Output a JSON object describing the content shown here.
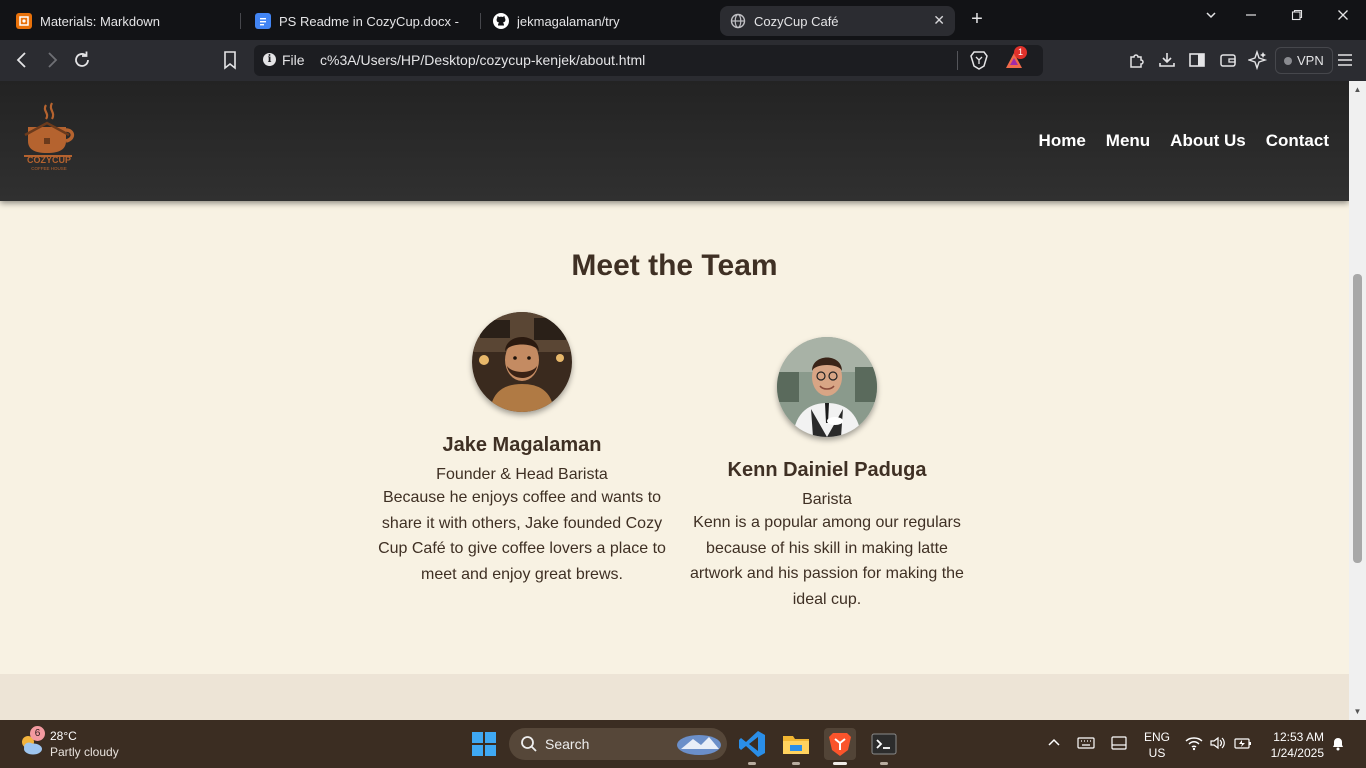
{
  "browser": {
    "tabs": [
      {
        "title": "Materials: Markdown",
        "icon": "materials-favicon",
        "color": "#e8710a"
      },
      {
        "title": "PS Readme in CozyCup.docx - Goog",
        "icon": "google-docs-favicon",
        "color": "#4285f4"
      },
      {
        "title": "jekmagalaman/try",
        "icon": "github-favicon",
        "color": "#ffffff"
      },
      {
        "title": "CozyCup Café",
        "icon": "globe-favicon",
        "color": "#c0c0c4"
      }
    ],
    "address": {
      "scheme_label": "File",
      "url": "c%3A/Users/HP/Desktop/cozycup-kenjek/about.html"
    },
    "rewards_badge": "1",
    "vpn_label": "VPN"
  },
  "site": {
    "logo_text": "COZYCUP",
    "logo_subtext": "COFFEE HOUSE",
    "nav": [
      "Home",
      "Menu",
      "About Us",
      "Contact"
    ],
    "section_title": "Meet the Team",
    "members": [
      {
        "name": "Jake Magalaman",
        "role": "Founder & Head Barista",
        "bio": "Because he enjoys coffee and wants to share it with others, Jake founded Cozy Cup Café to give coffee lovers a place to meet and enjoy great brews."
      },
      {
        "name": "Kenn Dainiel Paduga",
        "role": "Barista",
        "bio": "Kenn is a popular among our regulars because of his skill in making latte artwork and his passion for making the ideal cup."
      }
    ],
    "colors": {
      "header": "#2a2a2a",
      "background": "#f8f2e3",
      "heading": "#3f3024",
      "logo": "#b5632f"
    }
  },
  "taskbar": {
    "weather": {
      "temp": "28°C",
      "condition": "Partly cloudy",
      "badge": "6"
    },
    "search_label": "Search",
    "language": {
      "line1": "ENG",
      "line2": "US"
    },
    "time": "12:53 AM",
    "date": "1/24/2025"
  }
}
